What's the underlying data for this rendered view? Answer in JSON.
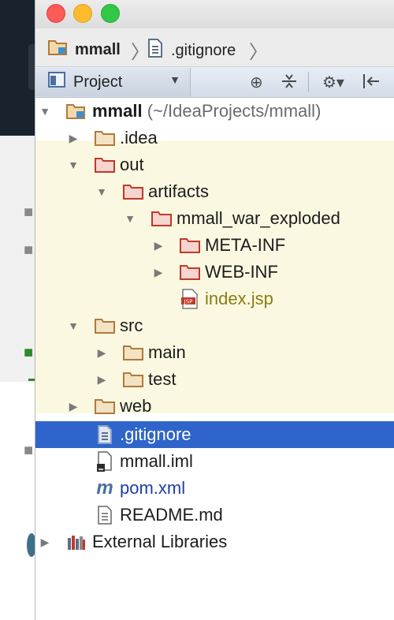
{
  "window": {
    "breadcrumb": [
      {
        "label": "mmall",
        "icon": "module-folder-icon"
      },
      {
        "label": ".gitignore",
        "icon": "text-file-icon"
      }
    ]
  },
  "toolwindow": {
    "view_selector_label": "Project",
    "toolbar_icons": [
      "scroll-from-source-icon",
      "collapse-all-icon",
      "gear-icon",
      "hide-icon"
    ]
  },
  "tree": {
    "root": {
      "label": "mmall",
      "hint": "(~/IdeaProjects/mmall)"
    },
    "items": [
      {
        "label": ".idea"
      },
      {
        "label": "out"
      },
      {
        "label": "artifacts"
      },
      {
        "label": "mmall_war_exploded"
      },
      {
        "label": "META-INF"
      },
      {
        "label": "WEB-INF"
      },
      {
        "label": "index.jsp"
      },
      {
        "label": "src"
      },
      {
        "label": "main"
      },
      {
        "label": "test"
      },
      {
        "label": "web"
      },
      {
        "label": ".gitignore"
      },
      {
        "label": "mmall.iml"
      },
      {
        "label": "pom.xml"
      },
      {
        "label": "README.md"
      },
      {
        "label": "External Libraries"
      }
    ]
  },
  "colors": {
    "selection": "#2f65ca",
    "excluded_band": "#fbf8e1",
    "excluded_folder": "#c0392b",
    "folder": "#c69c6d"
  }
}
